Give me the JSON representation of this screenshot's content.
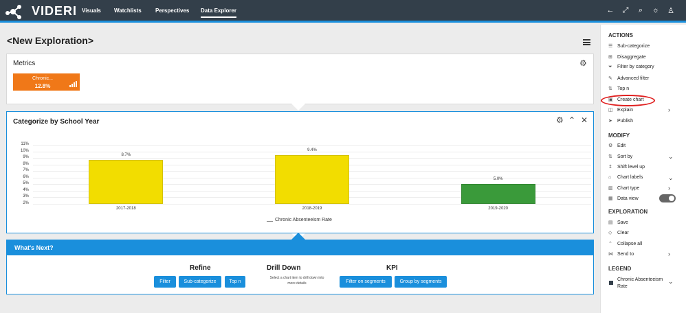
{
  "app": {
    "name": "VIDERI"
  },
  "nav": {
    "items": [
      "Visuals",
      "Watchlists",
      "Perspectives",
      "Data Explorer"
    ]
  },
  "page": {
    "title": "<New Exploration>"
  },
  "metrics": {
    "title": "Metrics",
    "tile": {
      "name": "Chronic...",
      "value": "12.8%",
      "color": "#f07818"
    }
  },
  "category_panel": {
    "title": "Categorize by School Year"
  },
  "chart_data": {
    "type": "bar",
    "categories": [
      "2017-2018",
      "2018-2019",
      "2019-2020"
    ],
    "series": [
      {
        "name": "Chronic Absenteeism Rate",
        "values": [
          8.7,
          9.4,
          5.0
        ]
      }
    ],
    "bar_labels": [
      "8.7%",
      "9.4%",
      "5.0%"
    ],
    "bar_colors": [
      "#f2dd00",
      "#f2dd00",
      "#3a9a3a"
    ],
    "y_ticks": [
      "11%",
      "10%",
      "9%",
      "8%",
      "7%",
      "6%",
      "5%",
      "4%",
      "3%",
      "2%"
    ],
    "ylim": [
      2,
      11
    ],
    "legend": "bottom"
  },
  "whats_next": {
    "title": "What's Next?",
    "refine": {
      "title": "Refine",
      "buttons": [
        "Filter",
        "Sub-categorize",
        "Top n"
      ]
    },
    "drill": {
      "title": "Drill Down",
      "desc": "Select a chart item to drill down into more details"
    },
    "kpi": {
      "title": "KPI",
      "buttons": [
        "Filter on segments",
        "Group by segments"
      ]
    }
  },
  "sidebar": {
    "actions_title": "ACTIONS",
    "actions": [
      "Sub-categorize",
      "Disaggregate",
      "Filter by category",
      "Advanced filter",
      "Top n",
      "Create chart",
      "Explain",
      "Publish"
    ],
    "modify_title": "MODIFY",
    "modify": [
      "Edit",
      "Sort by",
      "Shift level up",
      "Chart labels",
      "Chart type",
      "Data view"
    ],
    "exploration_title": "EXPLORATION",
    "exploration": [
      "Save",
      "Clear",
      "Collapse all",
      "Send to"
    ],
    "legend_title": "LEGEND",
    "legend_item": "Chronic Absenteeism Rate"
  },
  "colors": {
    "topbar": "#333f4a",
    "accent": "#1a8fdc",
    "metric": "#f07818"
  }
}
